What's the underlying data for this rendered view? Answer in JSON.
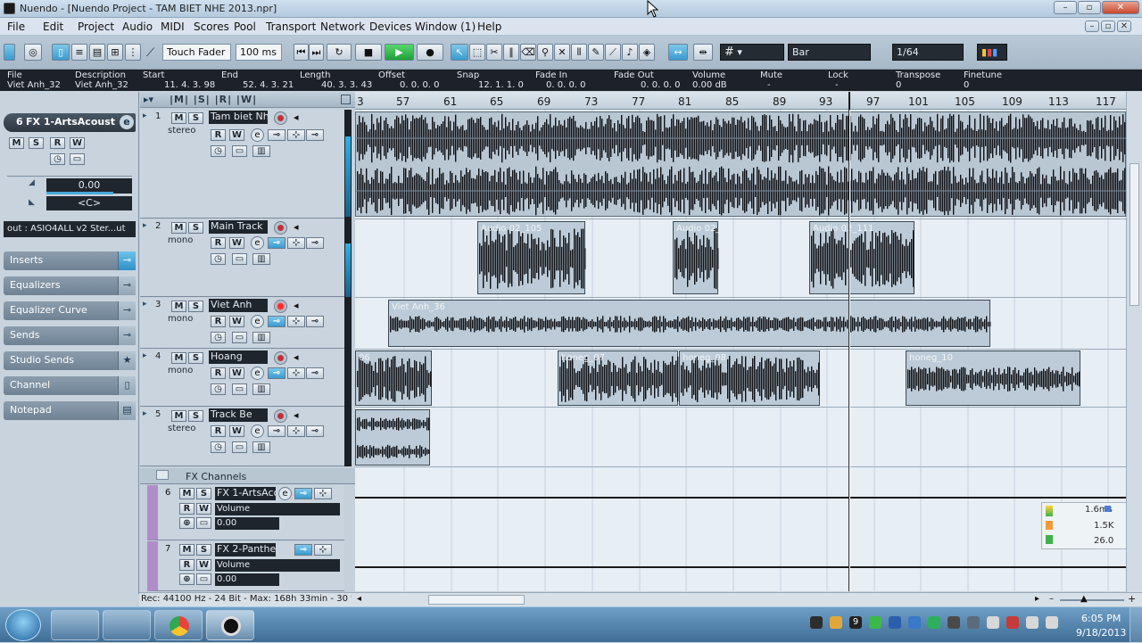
{
  "window": {
    "title": "Nuendo - [Nuendo Project - TAM BIET NHE 2013.npr]",
    "minimize": "–",
    "maximize": "▫",
    "close": "✕"
  },
  "menu": [
    "File",
    "Edit",
    "Project",
    "Audio",
    "MIDI",
    "Scores",
    "Pool",
    "Transport",
    "Network",
    "Devices",
    "Window (1)",
    "Help"
  ],
  "toolbar": {
    "automation_mode": "Touch Fader",
    "latency": "100 ms",
    "grid_type": "Bar",
    "quantize": "1/64"
  },
  "info_line": {
    "headers": [
      "File",
      "Description",
      "Start",
      "End",
      "Length",
      "Offset",
      "Snap",
      "Fade In",
      "Fade Out",
      "Volume",
      "Mute",
      "Lock",
      "Transpose",
      "Finetune"
    ],
    "values": [
      "Viet Anh_32",
      "Viet Anh_32",
      "11. 4. 3. 98",
      "52. 4. 3. 21",
      "40. 3. 3. 43",
      "0. 0. 0.  0",
      "12. 1. 1.  0",
      "0. 0. 0.  0",
      "0. 0. 0.  0",
      "0.00 dB",
      "-",
      "-",
      "0",
      "0"
    ]
  },
  "inspector": {
    "track_number": "6",
    "track_name": "FX 1-ArtsAcoustic",
    "volume": "0.00",
    "pan": "<C>",
    "output": "out : ASIO4ALL v2 Ster...ut",
    "sections": [
      "Inserts",
      "Equalizers",
      "Equalizer Curve",
      "Sends",
      "Studio Sends",
      "Channel",
      "Notepad"
    ]
  },
  "tracklist_header": "|M| |S| |R| |W|",
  "tracks": [
    {
      "num": "1",
      "name": "Tam biet Nhe",
      "type": "stereo"
    },
    {
      "num": "2",
      "name": "Main Track",
      "type": "mono"
    },
    {
      "num": "3",
      "name": "Viet Anh",
      "type": "mono"
    },
    {
      "num": "4",
      "name": "Hoang",
      "type": "mono"
    },
    {
      "num": "5",
      "name": "Track Be",
      "type": "stereo"
    }
  ],
  "fx_folder": "FX Channels",
  "fx_tracks": [
    {
      "num": "6",
      "name": "FX 1-ArtsAcou",
      "param": "Volume",
      "value": "0.00"
    },
    {
      "num": "7",
      "name": "FX 2-Pantheor",
      "param": "Volume",
      "value": "0.00"
    }
  ],
  "ruler": [
    "3",
    "57",
    "61",
    "65",
    "69",
    "73",
    "77",
    "81",
    "85",
    "89",
    "93",
    "97",
    "101",
    "105",
    "109",
    "113",
    "117"
  ],
  "clips": {
    "main": [
      "Audio 02_105",
      "Audio 02_",
      "Audio 02_111"
    ],
    "viet": "Viet Anh_36",
    "hoang": [
      "06",
      "honeg_07",
      "honeg_08",
      "honeg_10"
    ]
  },
  "status_line": "Rec: 44100 Hz - 24 Bit - Max: 168h 33min - 30 fps - R",
  "performance": {
    "latency": "1.6ms",
    "cpu": "1.5K",
    "disk": "26.0"
  },
  "clock": {
    "time": "6:05 PM",
    "date": "9/18/2013"
  },
  "colors": {
    "waveform": "#0e1014",
    "clip_bg": "#bccbd7",
    "play_green": "#2fb84a",
    "record_red": "#e0222c",
    "selection_blue": "#3a9bd0"
  }
}
